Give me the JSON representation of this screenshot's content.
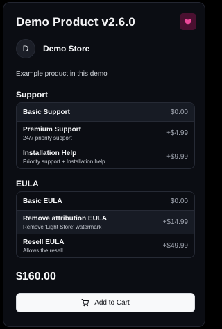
{
  "product": {
    "title": "Demo Product v2.6.0",
    "description": "Example product in this demo"
  },
  "store": {
    "avatar_letter": "D",
    "name": "Demo Store"
  },
  "favorite_icon": "heart-icon",
  "colors": {
    "accent": "#ec4899",
    "card_bg": "#0b0d13",
    "selected_bg": "#171b24"
  },
  "support": {
    "title": "Support",
    "options": [
      {
        "name": "Basic Support",
        "subtitle": "",
        "price": "$0.00",
        "selected": true
      },
      {
        "name": "Premium Support",
        "subtitle": "24/7 priority support",
        "price": "+$4.99",
        "selected": false
      },
      {
        "name": "Installation Help",
        "subtitle": "Priority support + Installation help",
        "price": "+$9.99",
        "selected": false
      }
    ]
  },
  "eula": {
    "title": "EULA",
    "options": [
      {
        "name": "Basic EULA",
        "subtitle": "",
        "price": "$0.00",
        "selected": false
      },
      {
        "name": "Remove attribution EULA",
        "subtitle": "Remove 'Light Store' watermark",
        "price": "+$14.99",
        "selected": true
      },
      {
        "name": "Resell EULA",
        "subtitle": "Allows the resell",
        "price": "+$49.99",
        "selected": false
      }
    ]
  },
  "total": "$160.00",
  "cart": {
    "label": "Add to Cart",
    "icon": "cart-icon"
  }
}
